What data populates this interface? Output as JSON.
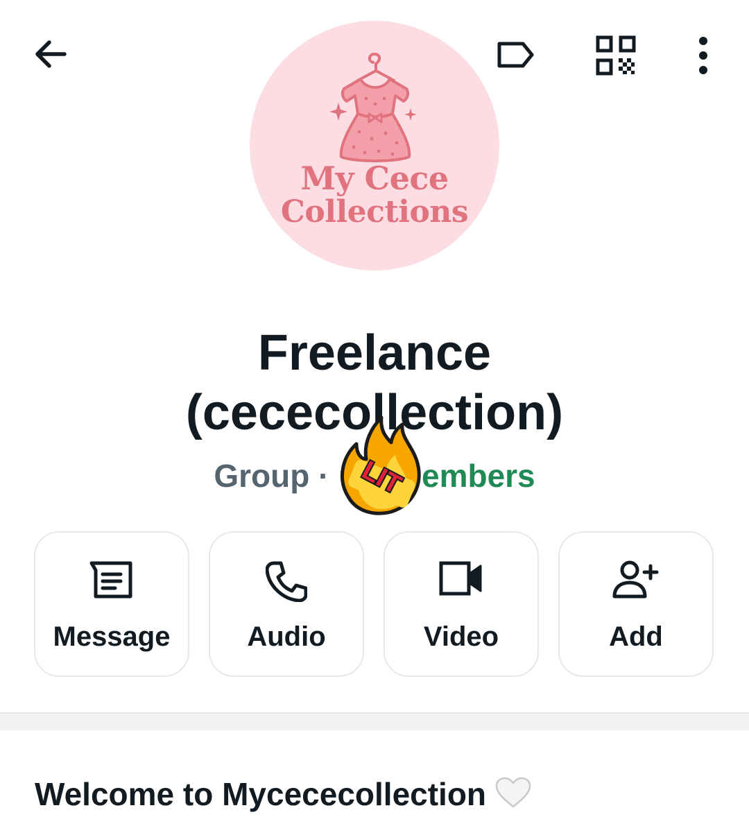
{
  "header": {
    "back_icon": "arrow-left-icon",
    "label_icon": "label-tag-icon",
    "qr_icon": "qr-code-icon",
    "menu_icon": "more-vertical-icon"
  },
  "avatar": {
    "logo_line1": "My Cece",
    "logo_line2": "Collections",
    "colors": {
      "background": "#fbdde3",
      "accent": "#e0737d"
    }
  },
  "group": {
    "name_line1": "Freelance",
    "name_line2": "(cececollection)",
    "type_label": "Group ·",
    "members_label": "embers",
    "sticker_text": "LIT"
  },
  "actions": [
    {
      "label": "Message",
      "icon": "message-icon"
    },
    {
      "label": "Audio",
      "icon": "phone-icon"
    },
    {
      "label": "Video",
      "icon": "video-camera-icon"
    },
    {
      "label": "Add",
      "icon": "add-person-icon"
    }
  ],
  "description": {
    "welcome_text": "Welcome to Mycececollection",
    "emoji": "white-heart-icon"
  },
  "colors": {
    "text": "#111b21",
    "secondary_text": "#54656f",
    "members_green": "#1f8a54"
  }
}
